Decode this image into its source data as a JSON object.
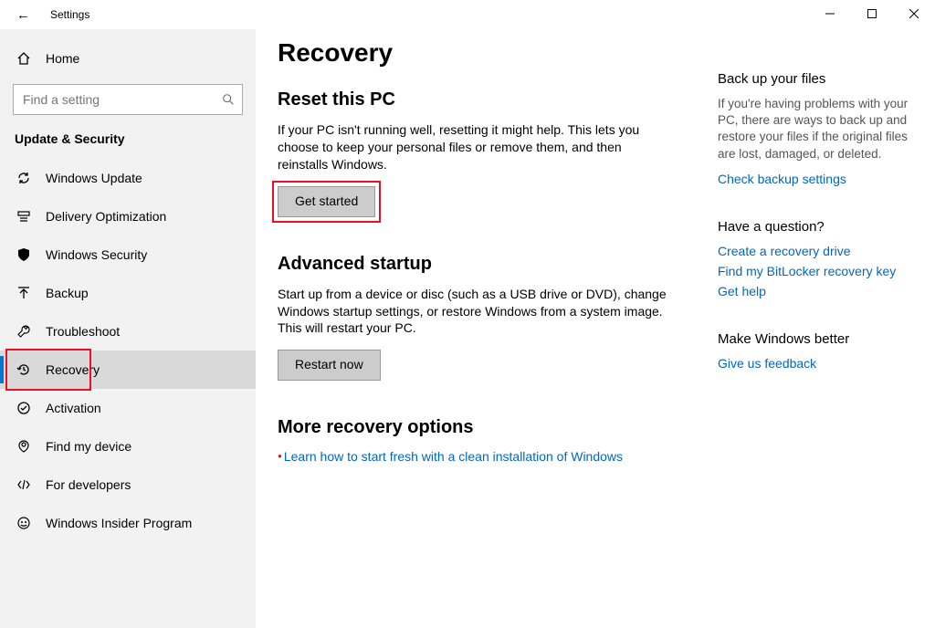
{
  "window": {
    "title": "Settings"
  },
  "sidebar": {
    "home_label": "Home",
    "search_placeholder": "Find a setting",
    "section_title": "Update & Security",
    "items": [
      {
        "label": "Windows Update"
      },
      {
        "label": "Delivery Optimization"
      },
      {
        "label": "Windows Security"
      },
      {
        "label": "Backup"
      },
      {
        "label": "Troubleshoot"
      },
      {
        "label": "Recovery"
      },
      {
        "label": "Activation"
      },
      {
        "label": "Find my device"
      },
      {
        "label": "For developers"
      },
      {
        "label": "Windows Insider Program"
      }
    ]
  },
  "page": {
    "title": "Recovery",
    "reset": {
      "heading": "Reset this PC",
      "desc": "If your PC isn't running well, resetting it might help. This lets you choose to keep your personal files or remove them, and then reinstalls Windows.",
      "button": "Get started"
    },
    "advanced": {
      "heading": "Advanced startup",
      "desc": "Start up from a device or disc (such as a USB drive or DVD), change Windows startup settings, or restore Windows from a system image. This will restart your PC.",
      "button": "Restart now"
    },
    "more": {
      "heading": "More recovery options",
      "link": "Learn how to start fresh with a clean installation of Windows"
    }
  },
  "right": {
    "backup": {
      "heading": "Back up your files",
      "desc": "If you're having problems with your PC, there are ways to back up and restore your files if the original files are lost, damaged, or deleted.",
      "link": "Check backup settings"
    },
    "question": {
      "heading": "Have a question?",
      "links": {
        "a": "Create a recovery drive",
        "b": "Find my BitLocker recovery key",
        "c": "Get help"
      }
    },
    "feedback": {
      "heading": "Make Windows better",
      "link": "Give us feedback"
    }
  }
}
